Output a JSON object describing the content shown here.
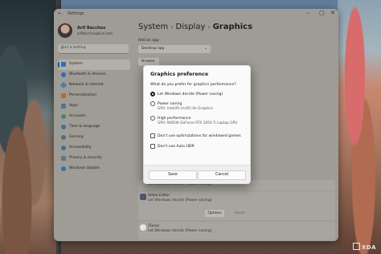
{
  "window": {
    "title": "Settings"
  },
  "profile": {
    "name": "Arif Bacchus",
    "email": "arifbacchus@live.com"
  },
  "search": {
    "placeholder": "Find a setting"
  },
  "sidebar": {
    "items": [
      {
        "label": "System",
        "color": "#2f6fb3"
      },
      {
        "label": "Bluetooth & devices",
        "color": "#2d6fb5"
      },
      {
        "label": "Network & internet",
        "color": "#4a7fa9"
      },
      {
        "label": "Personalization",
        "color": "#b46a3c"
      },
      {
        "label": "Apps",
        "color": "#5b6f86"
      },
      {
        "label": "Accounts",
        "color": "#3f8a6b"
      },
      {
        "label": "Time & language",
        "color": "#3970a8"
      },
      {
        "label": "Gaming",
        "color": "#5a6a7a"
      },
      {
        "label": "Accessibility",
        "color": "#3c6e9e"
      },
      {
        "label": "Privacy & security",
        "color": "#6b7280"
      },
      {
        "label": "Windows Update",
        "color": "#2f6fb3"
      }
    ]
  },
  "breadcrumb": {
    "part1": "System",
    "part2": "Display",
    "part3": "Graphics"
  },
  "main": {
    "add_app_label": "Add an app",
    "dropdown_value": "Desktop app",
    "browse_label": "Browse",
    "apps": [
      {
        "name": "Video Editor",
        "pref": "Let Windows decide (Power saving)"
      },
      {
        "name": "iTunes",
        "pref": "Let Windows decide (Power saving)"
      }
    ],
    "above_partial": "Let Windows decide (Power saving)",
    "options_label": "Options",
    "reset_label": "Reset"
  },
  "dialog": {
    "title": "Graphics preference",
    "question": "What do you prefer for graphics performance?",
    "options": [
      {
        "label": "Let Windows decide (Power saving)",
        "sub": "",
        "selected": true
      },
      {
        "label": "Power saving",
        "sub": "GPU: Intel(R) Iris(R) Xe Graphics",
        "selected": false
      },
      {
        "label": "High performance",
        "sub": "GPU: NVIDIA GeForce RTX 3050 Ti Laptop GPU",
        "selected": false
      }
    ],
    "checkboxes": [
      {
        "label": "Don't use optimizations for windowed games",
        "checked": false
      },
      {
        "label": "Don't use Auto HDR",
        "checked": false
      }
    ],
    "save_label": "Save",
    "cancel_label": "Cancel"
  },
  "watermark": {
    "text": "XDA"
  }
}
